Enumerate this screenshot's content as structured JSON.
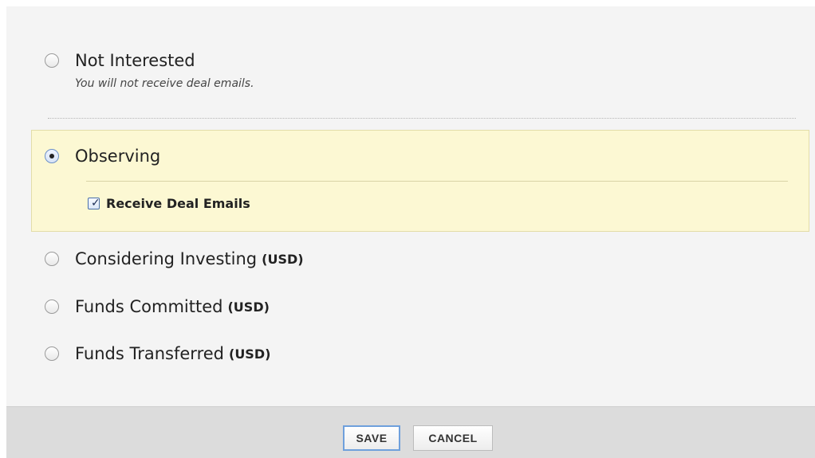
{
  "options": {
    "not_interested": {
      "label": "Not Interested",
      "description": "You will not receive deal emails.",
      "selected": false
    },
    "observing": {
      "label": "Observing",
      "selected": true,
      "checkbox_label": "Receive Deal Emails",
      "checkbox_checked": true
    },
    "considering": {
      "label": "Considering Investing",
      "currency": "(USD)",
      "selected": false
    },
    "committed": {
      "label": "Funds Committed",
      "currency": "(USD)",
      "selected": false
    },
    "transferred": {
      "label": "Funds Transferred",
      "currency": "(USD)",
      "selected": false
    }
  },
  "footer": {
    "save_label": "SAVE",
    "cancel_label": "CANCEL"
  },
  "colors": {
    "panel_background": "#f4f4f4",
    "selected_highlight": "#fcf8d3",
    "footer_background": "#dcdcdc",
    "focus_outline": "#6fa0dc"
  },
  "icons": {
    "check": "✓"
  }
}
